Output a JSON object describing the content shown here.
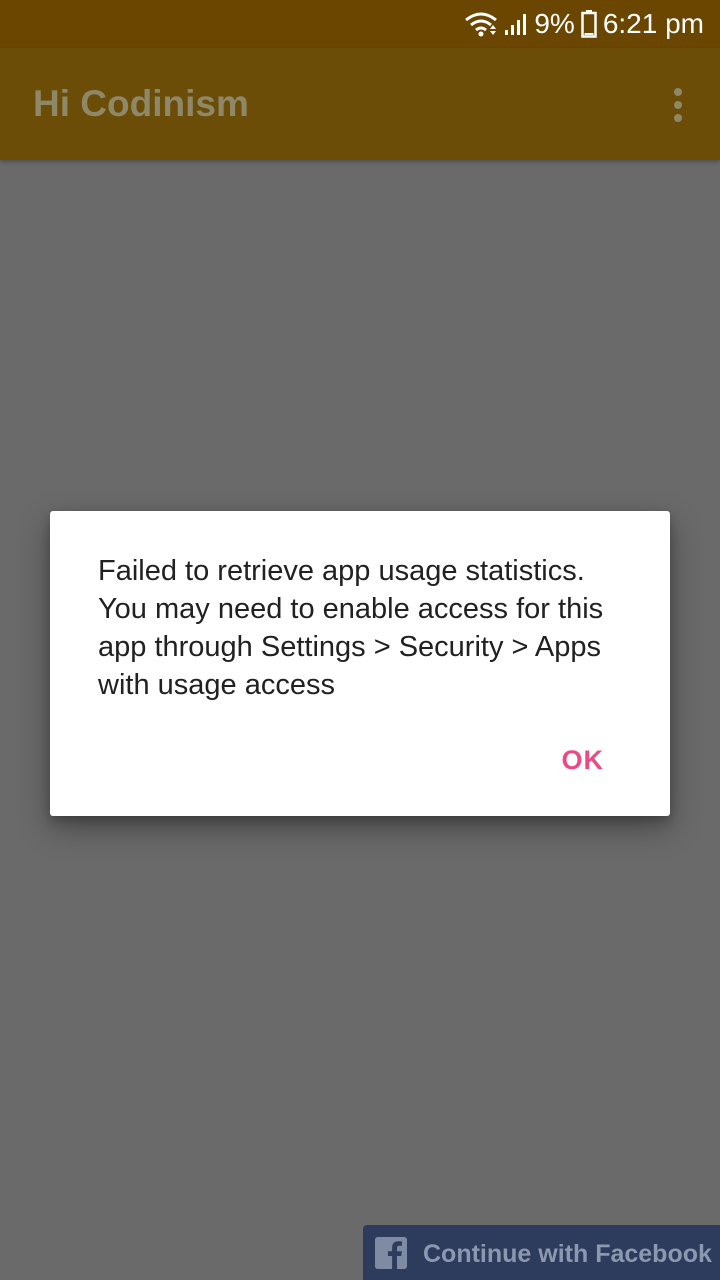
{
  "status_bar": {
    "battery_percent": "9%",
    "time": "6:21 pm",
    "icons": [
      "wifi-icon",
      "signal-icon",
      "battery-icon"
    ]
  },
  "app_bar": {
    "title": "Hi Codinism",
    "menu_icon": "overflow-menu-icon"
  },
  "dialog": {
    "message": "Failed to retrieve app usage statistics. You may need to enable access for this app through Settings > Security > Apps with usage access",
    "ok_label": "OK"
  },
  "facebook_button": {
    "label": "Continue with Facebook",
    "icon": "facebook-icon"
  },
  "colors": {
    "status_bar": "#6b4600",
    "app_bar": "#6b4d08",
    "scrim_background": "#6a6a6a",
    "dialog_accent": "#e94b86",
    "facebook_button": "#2d3c5c"
  }
}
